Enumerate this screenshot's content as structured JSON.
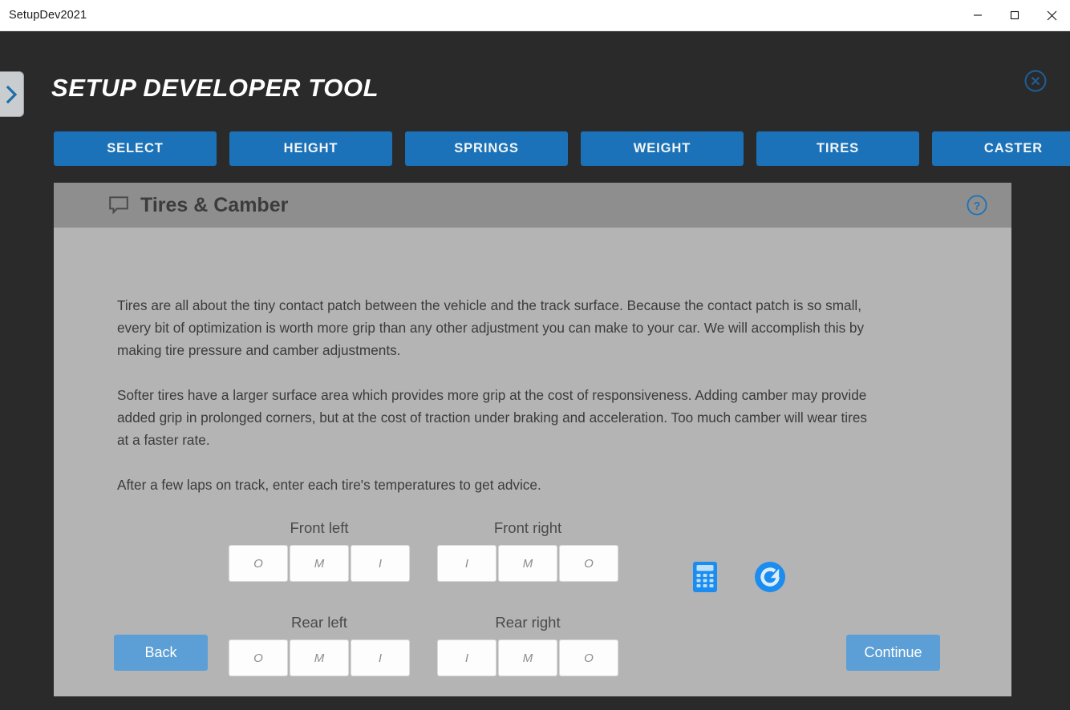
{
  "window": {
    "title": "SetupDev2021",
    "minimize_icon": "minimize-icon",
    "maximize_icon": "maximize-icon",
    "close_icon": "close-icon"
  },
  "app": {
    "title": "SETUP DEVELOPER TOOL",
    "sidebar_toggle_icon": "chevron-right-icon",
    "close_icon": "close-circle-icon",
    "accent_blue": "#1b72b8",
    "button_blue": "#5b9fd6",
    "chrome_dark": "#2a2a2a",
    "card_bg": "#b4b4b4",
    "card_header_bg": "#8e8e8e"
  },
  "nav": {
    "tabs": [
      {
        "label": "SELECT"
      },
      {
        "label": "HEIGHT"
      },
      {
        "label": "SPRINGS"
      },
      {
        "label": "WEIGHT"
      },
      {
        "label": "TIRES"
      },
      {
        "label": "CASTER"
      }
    ]
  },
  "card": {
    "icon": "speech-bubble-icon",
    "title": "Tires & Camber",
    "help_icon": "question-circle-icon",
    "paragraphs": [
      "Tires are all about the tiny contact patch between the vehicle and the track surface. Because the contact patch is so small, every bit of optimization is worth more grip than any other adjustment you can make to your car. We will accomplish this by making tire pressure and camber adjustments.",
      "Softer tires have a larger surface area which provides more grip at the cost of responsiveness. Adding camber may provide added grip in prolonged corners, but at the cost of traction under braking and acceleration. Too much camber will wear tires at a faster rate.",
      "After a few laps on track, enter each tire's temperatures to get advice."
    ]
  },
  "tires": {
    "corners": [
      {
        "key": "front-left",
        "label": "Front left",
        "fields": [
          {
            "name": "front-left-outer",
            "placeholder": "O",
            "value": ""
          },
          {
            "name": "front-left-middle",
            "placeholder": "M",
            "value": ""
          },
          {
            "name": "front-left-inner",
            "placeholder": "I",
            "value": ""
          }
        ]
      },
      {
        "key": "front-right",
        "label": "Front right",
        "fields": [
          {
            "name": "front-right-inner",
            "placeholder": "I",
            "value": ""
          },
          {
            "name": "front-right-middle",
            "placeholder": "M",
            "value": ""
          },
          {
            "name": "front-right-outer",
            "placeholder": "O",
            "value": ""
          }
        ]
      },
      {
        "key": "rear-left",
        "label": "Rear left",
        "fields": [
          {
            "name": "rear-left-outer",
            "placeholder": "O",
            "value": ""
          },
          {
            "name": "rear-left-middle",
            "placeholder": "M",
            "value": ""
          },
          {
            "name": "rear-left-inner",
            "placeholder": "I",
            "value": ""
          }
        ]
      },
      {
        "key": "rear-right",
        "label": "Rear right",
        "fields": [
          {
            "name": "rear-right-inner",
            "placeholder": "I",
            "value": ""
          },
          {
            "name": "rear-right-middle",
            "placeholder": "M",
            "value": ""
          },
          {
            "name": "rear-right-outer",
            "placeholder": "O",
            "value": ""
          }
        ]
      }
    ],
    "tools": [
      {
        "name": "calculator-icon"
      },
      {
        "name": "reset-refresh-icon"
      }
    ]
  },
  "footer": {
    "back_label": "Back",
    "continue_label": "Continue"
  }
}
